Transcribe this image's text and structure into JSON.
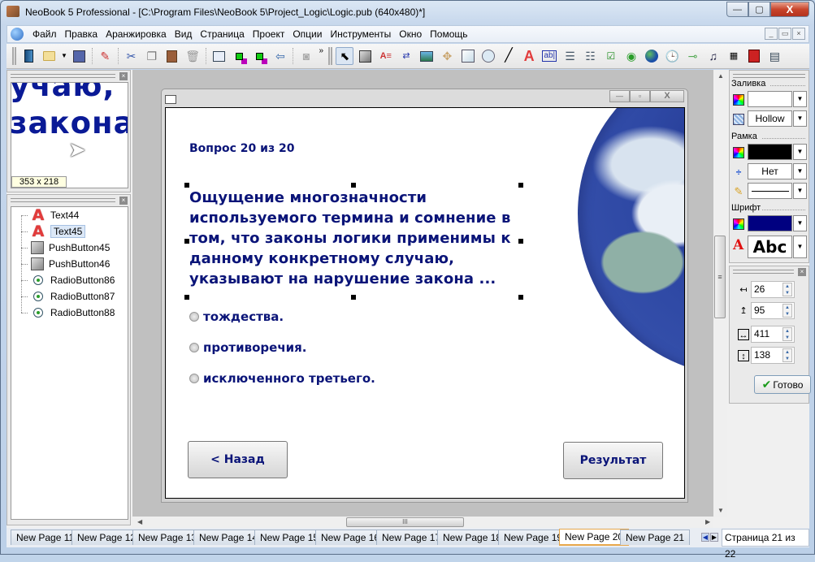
{
  "window": {
    "title": "NeoBook 5 Professional - [C:\\Program Files\\NeoBook 5\\Project_Logic\\Logic.pub (640x480)*]",
    "minimize": "—",
    "maximize": "▢",
    "close": "X"
  },
  "menu": {
    "items": [
      "Файл",
      "Правка",
      "Аранжировка",
      "Вид",
      "Страница",
      "Проект",
      "Опции",
      "Инструменты",
      "Окно",
      "Помощь"
    ],
    "mdi": [
      "_",
      "▭",
      "×"
    ]
  },
  "toolbar": {
    "more": "»",
    "icons": [
      "new-project-icon",
      "open-folder-icon",
      "dropdown-icon",
      "save-icon",
      "paint-brush-icon",
      "cut-icon",
      "copy-icon",
      "paste-icon",
      "delete-icon",
      "properties-icon",
      "group-icon",
      "ungroup-icon",
      "bring-front-icon",
      "align-icon",
      "pointer-icon",
      "push-button-icon",
      "text-box-icon",
      "text-link-icon",
      "picture-icon",
      "plugin-icon",
      "rectangle-icon",
      "ellipse-icon",
      "line-icon",
      "text-object-icon",
      "text-entry-icon",
      "list-box-icon",
      "combo-box-icon",
      "check-box-icon",
      "radio-button-icon",
      "web-browser-icon",
      "timer-icon",
      "trackbar-icon",
      "media-player-icon",
      "animation-icon",
      "flash-icon",
      "gallery-icon"
    ]
  },
  "preview": {
    "text_line1": "учаю,",
    "text_line2": "закона",
    "size": "353 x 218"
  },
  "object_tree": {
    "items": [
      {
        "label": "Text44",
        "type": "text"
      },
      {
        "label": "Text45",
        "type": "text",
        "selected": true
      },
      {
        "label": "PushButton45",
        "type": "push"
      },
      {
        "label": "PushButton46",
        "type": "push"
      },
      {
        "label": "RadioButton86",
        "type": "radio"
      },
      {
        "label": "RadioButton87",
        "type": "radio"
      },
      {
        "label": "RadioButton88",
        "type": "radio"
      }
    ]
  },
  "page": {
    "counter": "Вопрос 20 из 20",
    "question": "Ощущение многозначности используемого термина и сомнение в том, что законы логики применимы к данному конкретному случаю, указывают на нарушение закона ...",
    "answers": [
      "тождества.",
      "противоречия.",
      "исключенного третьего."
    ],
    "back_button": "< Назад",
    "result_button": "Результат",
    "text_color": "#0a1478"
  },
  "properties": {
    "fill_label": "Заливка",
    "fill_color": "#ffffff",
    "fill_pattern": "Hollow",
    "border_label": "Рамка",
    "border_color": "#000000",
    "border_width": "Нет",
    "border_style": "solid",
    "font_label": "Шрифт",
    "font_color": "#000080",
    "font_sample": "Abc",
    "x": "26",
    "y": "95",
    "width": "411",
    "height": "138",
    "done_button": "Готово"
  },
  "tabs": {
    "items": [
      "New Page 11",
      "New Page 12",
      "New Page 13",
      "New Page 14",
      "New Page 15",
      "New Page 16",
      "New Page 17",
      "New Page 18",
      "New Page 19",
      "New Page 20",
      "New Page 21"
    ],
    "active_index": 9,
    "status": "Страница 21 из 22"
  }
}
